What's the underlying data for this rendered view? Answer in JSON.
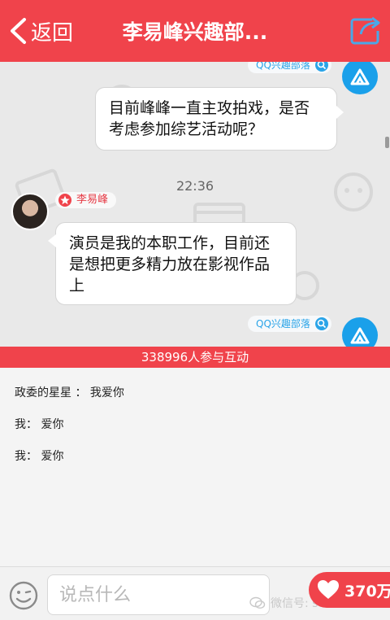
{
  "header": {
    "back_label": "返回",
    "title": "李易峰兴趣部..."
  },
  "chat": {
    "source_tag": "QQ兴趣部落",
    "question": "目前峰峰一直主攻拍戏，是否考虑参加综艺活动呢？",
    "time": "22:36",
    "answer_author": "李易峰",
    "answer": "演员是我的本职工作，目前还是想把更多精力放在影视作品上",
    "source_tag_2": "QQ兴趣部落"
  },
  "participation": "338996人参与互动",
  "comments": [
    {
      "author": "政委的星星",
      "separator": " ：",
      "text": " 我爱你"
    },
    {
      "author": "我",
      "separator": "：",
      "text": " 爱你"
    },
    {
      "author": "我",
      "separator": "：",
      "text": " 爱你"
    }
  ],
  "bottom": {
    "input_placeholder": "说点什么",
    "like_count": "370万",
    "watermark": "微信号: sdu51520"
  },
  "colors": {
    "brand_red": "#f0434b",
    "qq_blue": "#1aa0ea"
  },
  "icons": [
    "back-icon",
    "share-icon",
    "qq-tribe-icon",
    "search-icon",
    "star-icon",
    "emoji-icon",
    "heart-icon",
    "wechat-icon"
  ]
}
